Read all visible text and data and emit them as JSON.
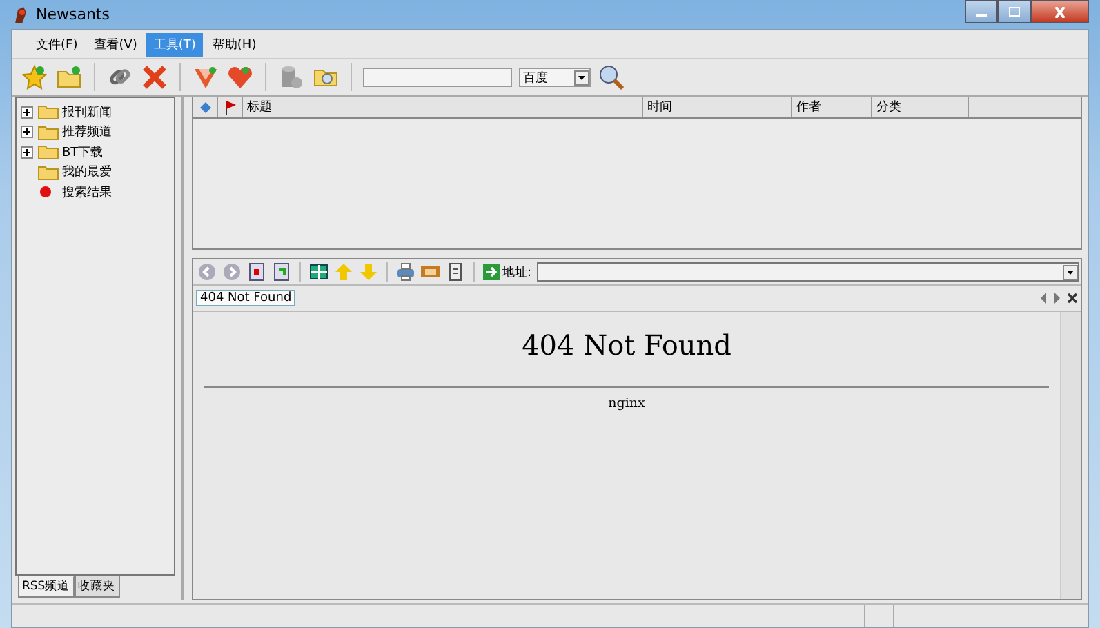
{
  "window": {
    "title": "Newsants"
  },
  "menu": [
    {
      "label": "文件(F)",
      "selected": false
    },
    {
      "label": "查看(V)",
      "selected": false
    },
    {
      "label": "工具(T)",
      "selected": true
    },
    {
      "label": "帮助(H)",
      "selected": false
    }
  ],
  "search": {
    "engine": "百度"
  },
  "tree": [
    {
      "label": "报刊新闻",
      "kind": "group",
      "expanded": false
    },
    {
      "label": "推荐频道",
      "kind": "group",
      "expanded": false
    },
    {
      "label": "BT下载",
      "kind": "group",
      "expanded": false
    },
    {
      "label": "我的最爱",
      "kind": "folder"
    },
    {
      "label": "搜索结果",
      "kind": "result"
    }
  ],
  "left_tabs": [
    {
      "label": "RSS频道",
      "selected": true
    },
    {
      "label": "收藏夹",
      "selected": false
    }
  ],
  "table": {
    "columns": [
      "标题",
      "时间",
      "作者",
      "分类"
    ]
  },
  "browser": {
    "address_label": "地址:",
    "tab": "404 Not Found",
    "page": {
      "heading": "404 Not Found",
      "footer": "nginx"
    }
  }
}
